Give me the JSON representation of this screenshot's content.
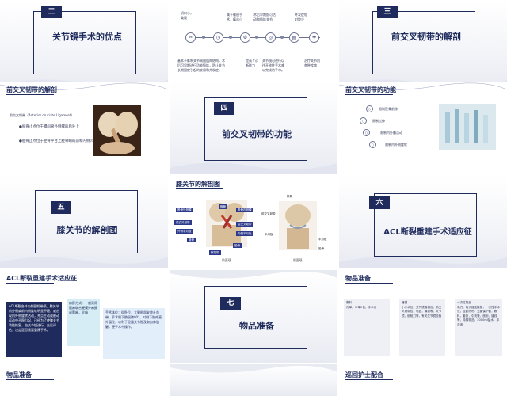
{
  "slides": {
    "s1": {
      "num": "二",
      "title": "关节镜手术的优点"
    },
    "s2": {
      "top_texts": [
        "切口小，\n美观",
        "属于微创手\n术，痛苦小",
        "术后早期即可活\n动和锻炼关节",
        "并发症相\n对较少"
      ],
      "bottom_texts": [
        "基本不影响关节周围肌肉结构，术\n后可早期进行功能锻炼，防止关节\n长期固定引起的废用和并发症。",
        "提高了诊\n断能力",
        "关节镜可进行以\n往开放性手术难\n以完成的手术。",
        "治疗关节内\n各种疾病"
      ]
    },
    "s3": {
      "num": "三",
      "title": "前交叉韧带的解剖"
    },
    "s4": {
      "heading": "前交叉韧带的解剖",
      "label": "前交叉韧带（Anterior cruciate Ligament）",
      "bullets": [
        "●股骨止点位于髁间窝外侧髁的后外上",
        "●胫骨止点位于胫骨平台上胫骨嵴的前和内侧凹"
      ]
    },
    "s5": {
      "num": "四",
      "title": "前交叉韧带的功能"
    },
    "s6": {
      "heading": "前交叉韧带的功能",
      "items": [
        "限制胫骨前移",
        "限制过伸",
        "限制内外翻活动",
        "限制内外侧旋转"
      ]
    },
    "s7": {
      "num": "五",
      "title": "膝关节的解剖图"
    },
    "s8": {
      "heading": "膝关节的解剖图",
      "left_labels": [
        "股骨外侧髁",
        "前交叉韧带",
        "外侧半月板",
        "腓骨"
      ],
      "right_labels_a": [
        "股骨内侧髁",
        "后交叉韧带",
        "内侧半月板",
        "胫骨"
      ],
      "mid_labels": [
        "髌骨"
      ],
      "right_img_labels": [
        "髌骨",
        "前交叉韧带",
        "半月板",
        "半月板",
        "胫骨"
      ],
      "bottom_label": "髌韧带",
      "captions": [
        "前面观",
        "侧面观"
      ]
    },
    "s9": {
      "num": "六",
      "title": "ACL断裂重建手术适应征"
    },
    "s10": {
      "heading": "ACL断裂重建手术适应征",
      "card1": "ACL断裂合并内侧副韧带损，膝关节前外侧或前内侧旋转明显不稳，或出现内外侧旋转活动，并且主动或被动运动中不稳引起，已经为了使膝关节功能恢复，由关节镜进行，先后评估，决定是否需要重建手术。",
      "card2": "麻醉方式：一般采用腰麻联合硬膜外麻醉或腰麻，全麻",
      "card3": "手术体位：仰卧位，大腿根部安放止血带，手术侧下肢屈膝90°，对侧下肢伸直外展位，以利于显露关节腔及取自体肌腱，便于术中操作。",
      "card_labels": [
        "麻醉方式：一般采用腰麻联合硬膜外麻醉或腰麻和全身麻醉方式。"
      ]
    },
    "s11": {
      "num": "七",
      "title": "物品准备"
    },
    "s12": {
      "heading": "物品准备",
      "cols": [
        {
          "title": "敷料",
          "body": "孔单，中单2包，手术衣"
        },
        {
          "title": "器械",
          "body": "小手术包，关节镜器械包，前交叉韧带包，电钻，髁钳等，关节镜，刨削刀等，有关关节镜设备"
        },
        {
          "title": "一次性物品",
          "body": "电刀，吸引器连接管，一次性手术衣，显影纱布，无菌保护套，敷料，套针，引流管，刨削，缝线等，特殊物品，3000ml盐水，冲洗液"
        }
      ]
    },
    "s13": {
      "heading": "物品准备"
    },
    "s15": {
      "heading": "巡回护士配合"
    }
  }
}
